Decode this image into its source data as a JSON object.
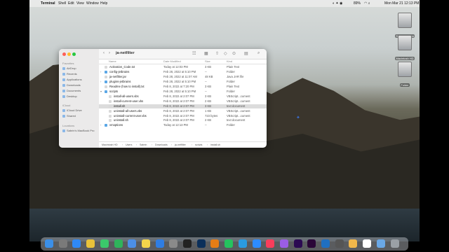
{
  "menubar": {
    "app": "Terminal",
    "items": [
      "Shell",
      "Edit",
      "View",
      "Window",
      "Help"
    ],
    "battery": "89%",
    "datetime": "Mon Mar 21  12:13 PM"
  },
  "desktop_icons": [
    {
      "label": "Sabrin Hamza"
    },
    {
      "label": "Macintosh HD"
    },
    {
      "label": "Folder"
    }
  ],
  "finder": {
    "title": "ja-netfilter",
    "sidebar": {
      "favorites_header": "Favorites",
      "favorites": [
        "AirDrop",
        "Recents",
        "Applications",
        "Downloads",
        "Documents",
        "Desktop"
      ],
      "icloud_header": "iCloud",
      "icloud": [
        "iCloud Drive",
        "Shared"
      ],
      "locations_header": "Locations",
      "locations": [
        "Sabrin's MacBook Pro"
      ]
    },
    "columns": {
      "name": "Name",
      "date": "Date Modified",
      "size": "Size",
      "kind": "Kind"
    },
    "rows": [
      {
        "name": "Activation_Code.txt",
        "date": "Today at 12:03 PM",
        "size": "3 KB",
        "kind": "Plain Text",
        "type": "file"
      },
      {
        "name": "config-jetbrains",
        "date": "Feb 28, 2022 at 5:10 PM",
        "size": "--",
        "kind": "Folder",
        "type": "folder"
      },
      {
        "name": "ja-netfilter.jar",
        "date": "Feb 28, 2022 at 11:07 AM",
        "size": "48 KB",
        "kind": "Java JAR file",
        "type": "file"
      },
      {
        "name": "plugins-jetbrains",
        "date": "Feb 28, 2022 at 5:10 PM",
        "size": "--",
        "kind": "Folder",
        "type": "folder"
      },
      {
        "name": "Readme (how to install).txt",
        "date": "Feb 8, 2022 at 7:20 PM",
        "size": "3 KB",
        "kind": "Plain Text",
        "type": "file"
      },
      {
        "name": "scripts",
        "date": "Feb 28, 2022 at 5:10 PM",
        "size": "--",
        "kind": "Folder",
        "type": "folder"
      },
      {
        "name": "install-all-users.vbs",
        "date": "Feb 8, 2022 at 2:07 PM",
        "size": "3 KB",
        "kind": "VBScript...cument",
        "type": "file"
      },
      {
        "name": "install-current-user.vbs",
        "date": "Feb 8, 2022 at 2:07 PM",
        "size": "2 KB",
        "kind": "VBScript...cument",
        "type": "file"
      },
      {
        "name": "install.sh",
        "date": "Feb 8, 2022 at 2:07 PM",
        "size": "3 KB",
        "kind": "text document",
        "type": "file"
      },
      {
        "name": "uninstall-all-users.vbs",
        "date": "Feb 8, 2022 at 2:07 PM",
        "size": "1 KB",
        "kind": "VBScript...cument",
        "type": "file"
      },
      {
        "name": "uninstall-current-user.vbs",
        "date": "Feb 8, 2022 at 2:07 PM",
        "size": "723 bytes",
        "kind": "VBScript...cument",
        "type": "file"
      },
      {
        "name": "uninstall.sh",
        "date": "Feb 8, 2022 at 2:07 PM",
        "size": "2 KB",
        "kind": "text document",
        "type": "file"
      },
      {
        "name": "vmoptions",
        "date": "Today at 12:13 PM",
        "size": "--",
        "kind": "Folder",
        "type": "folder"
      }
    ],
    "selected_index": 8,
    "pathbar": [
      "Macintosh HD",
      "Users",
      "Sabrin",
      "Downloads",
      "ja-netfilter",
      "scripts",
      "install.sh"
    ]
  },
  "colors": {
    "folder": "#5aa7e6",
    "file": "#d9d9d9",
    "selection": "#dcdcdc",
    "close": "#fe5f57",
    "minimize": "#febc2e",
    "zoom": "#28c840"
  },
  "dock": {
    "apps": [
      "finder-icon",
      "launchpad-icon",
      "safari-icon",
      "chrome-icon",
      "messages-icon",
      "facetime-icon",
      "mail-icon",
      "notes-icon",
      "appstore-icon",
      "system-preferences-icon",
      "terminal-icon",
      "photoshop-icon",
      "vlc-icon",
      "whatsapp-icon",
      "telegram-icon",
      "zoom-icon",
      "music-icon",
      "podcasts-icon",
      "ae-icon",
      "pr-icon",
      "vscode-icon",
      "activity-icon",
      "photos-icon",
      "calendar-icon",
      "folder-icon",
      "trash-icon"
    ]
  }
}
